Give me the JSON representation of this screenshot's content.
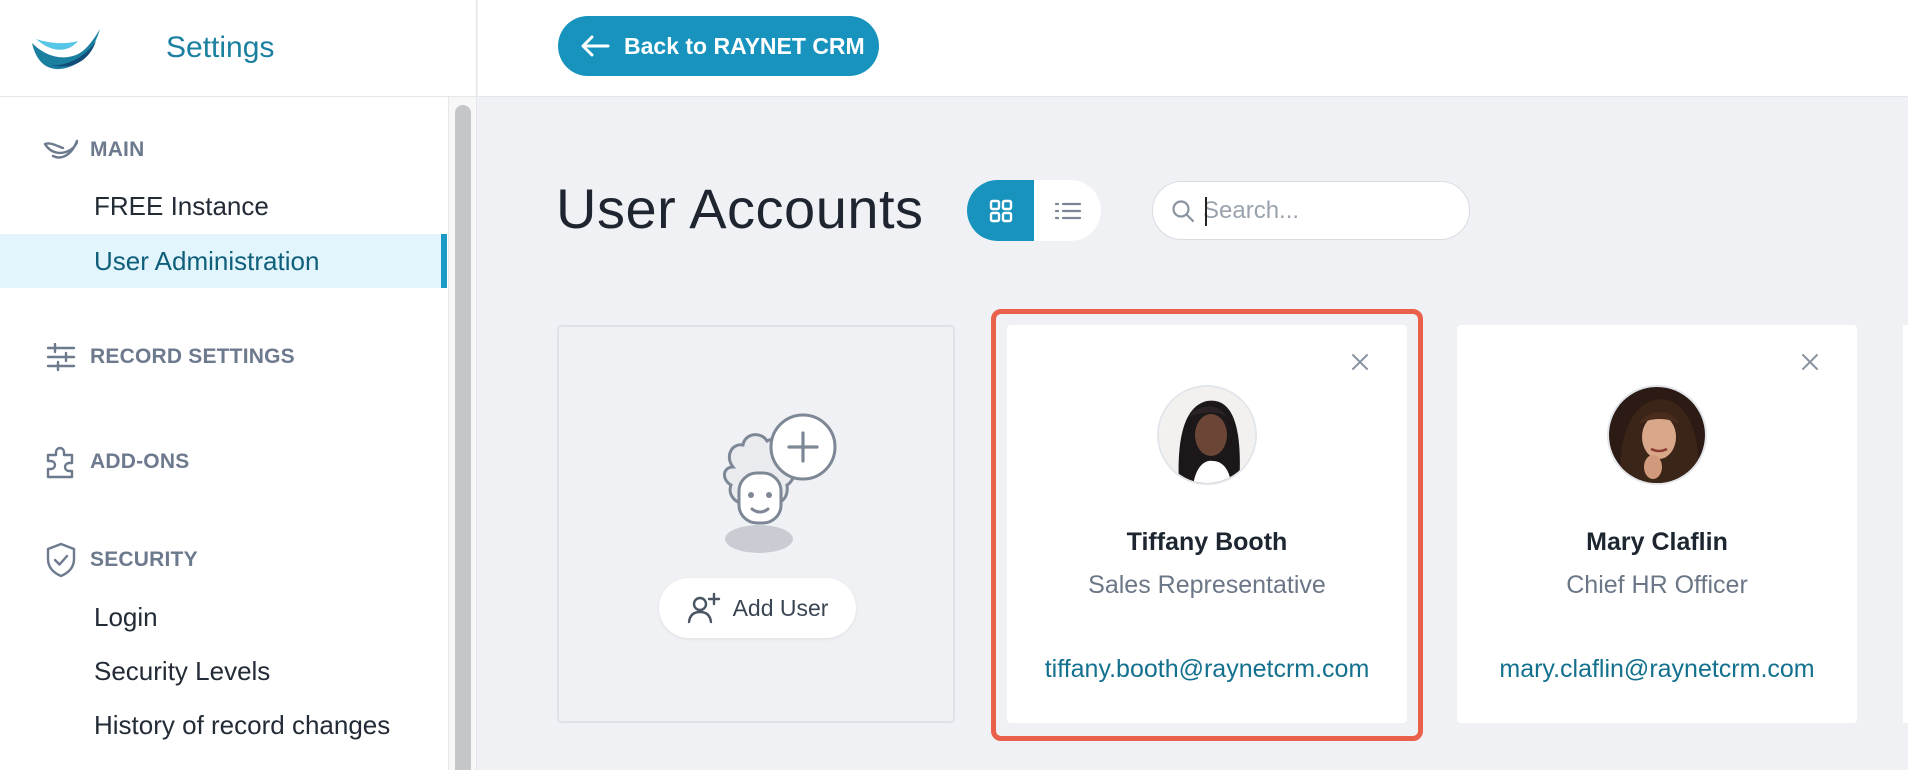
{
  "sidebar": {
    "title": "Settings",
    "sections": {
      "main": {
        "label": "MAIN",
        "items": [
          "FREE Instance",
          "User Administration"
        ]
      },
      "record_settings": {
        "label": "RECORD SETTINGS"
      },
      "addons": {
        "label": "ADD-ONS"
      },
      "security": {
        "label": "SECURITY",
        "items": [
          "Login",
          "Security Levels",
          "History of record changes"
        ]
      }
    },
    "active_item": "User Administration"
  },
  "topbar": {
    "back_label": "Back to RAYNET CRM"
  },
  "main": {
    "title": "User Accounts",
    "search_placeholder": "Search...",
    "view_mode": "grid",
    "add_user_label": "Add User",
    "users": [
      {
        "name": "Tiffany Booth",
        "role": "Sales Representative",
        "email": "tiffany.booth@raynetcrm.com"
      },
      {
        "name": "Mary Claflin",
        "role": "Chief HR Officer",
        "email": "mary.claflin@raynetcrm.com"
      }
    ]
  },
  "colors": {
    "accent": "#1793bd",
    "highlight": "#e9614a",
    "link": "#13708e"
  }
}
